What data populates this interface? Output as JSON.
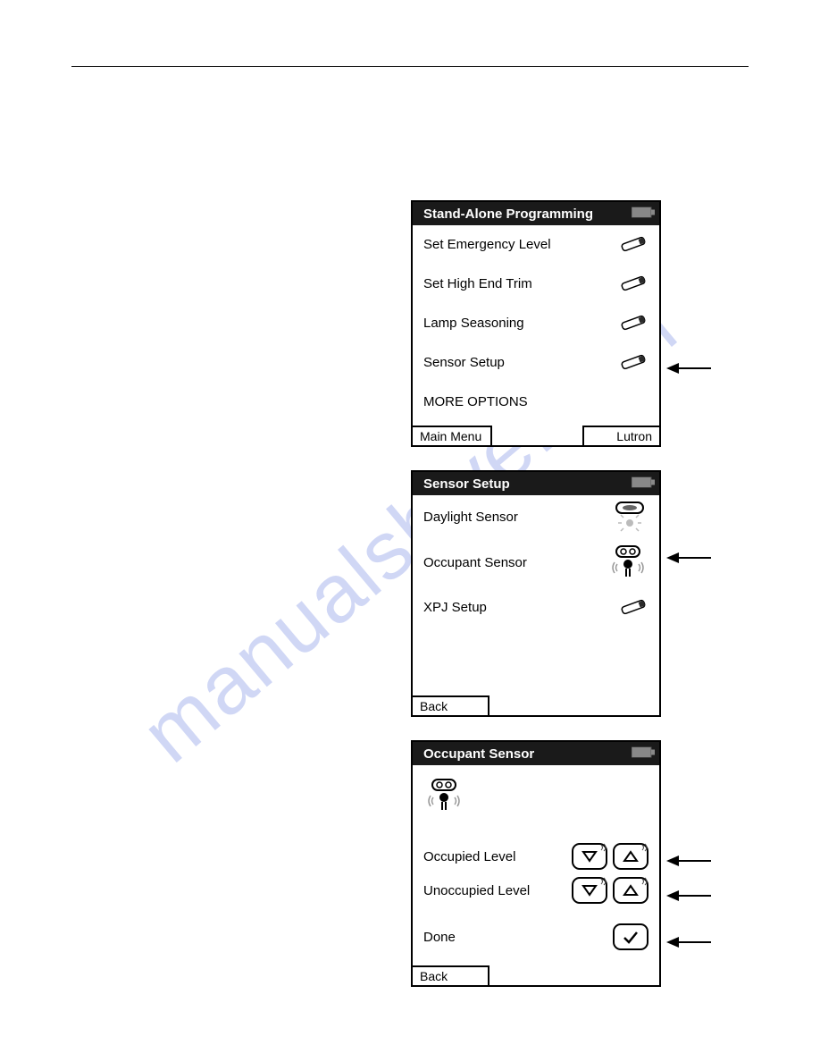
{
  "watermark": "manualshive.com",
  "screen1": {
    "title": "Stand-Alone Programming",
    "items": [
      {
        "label": "Set Emergency Level"
      },
      {
        "label": "Set High End Trim"
      },
      {
        "label": "Lamp Seasoning"
      },
      {
        "label": "Sensor Setup"
      },
      {
        "label": "MORE OPTIONS"
      }
    ],
    "footerLeft": "Main Menu",
    "footerRight": "Lutron"
  },
  "screen2": {
    "title": "Sensor Setup",
    "items": [
      {
        "label": "Daylight Sensor"
      },
      {
        "label": "Occupant Sensor"
      },
      {
        "label": "XPJ Setup"
      }
    ],
    "footerLeft": "Back"
  },
  "screen3": {
    "title": "Occupant Sensor",
    "rows": [
      {
        "label": "Occupied Level"
      },
      {
        "label": "Unoccupied Level"
      }
    ],
    "done": "Done",
    "footerLeft": "Back"
  }
}
